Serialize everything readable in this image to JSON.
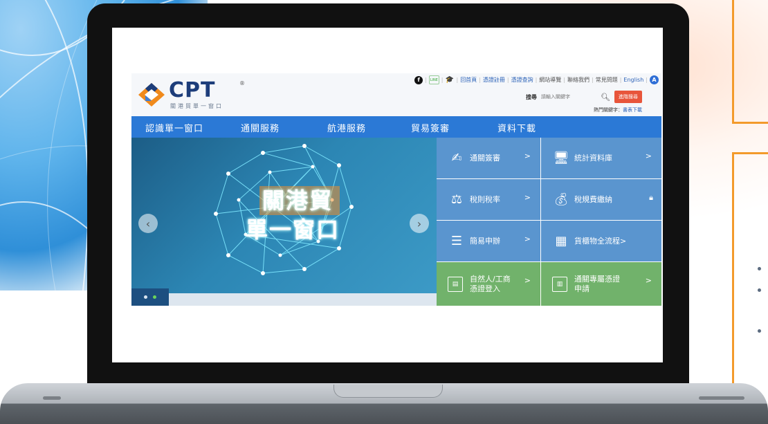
{
  "site": {
    "logo_text": "CPT",
    "logo_reg": "®",
    "logo_sub": "關港貿單一窗口",
    "toplinks": [
      "回首頁",
      "憑證註冊",
      "憑證查詢",
      "網站導覽",
      "聯絡我們",
      "常見問題",
      "English"
    ],
    "a11y_label": "A",
    "search_label": "搜尋",
    "search_placeholder": "請輸入關鍵字",
    "advanced_search": "進階搜尋",
    "hot_keywords_label": "熱門關鍵字：",
    "hot_keyword": "書表下載",
    "nav": [
      "認識單一窗口",
      "通關服務",
      "航港服務",
      "貿易簽審",
      "資料下載"
    ],
    "hero_caption_line1": "關港貿",
    "hero_caption_line2": "單一窗口",
    "tiles": [
      {
        "label": "通關簽審",
        "chevron": ">",
        "icon": "edit-icon",
        "color": "#5a95cf"
      },
      {
        "label": "統計資料庫",
        "chevron": ">",
        "icon": "monitor-icon",
        "color": "#5a95cf"
      },
      {
        "label": "稅則稅率",
        "chevron": ">",
        "icon": "scale-icon",
        "color": "#5a95cf"
      },
      {
        "label": "稅規費繳納",
        "chevron": "",
        "icon": "payment-icon",
        "color": "#5a95cf"
      },
      {
        "label": "簡易申辦",
        "chevron": ">",
        "icon": "list-icon",
        "color": "#5a95cf"
      },
      {
        "label": "貨櫃物全流程>",
        "chevron": "",
        "icon": "cargo-icon",
        "color": "#5a95cf"
      },
      {
        "label": "自然人/工商\n憑證登入",
        "chevron": ">",
        "icon": "id-card-icon",
        "color": "#71b26b"
      },
      {
        "label": "通關專屬憑證\n申請",
        "chevron": ">",
        "icon": "certificate-icon",
        "color": "#71b26b"
      }
    ],
    "carousel_active_index": 1,
    "colors": {
      "nav": "#2b79d6",
      "accent_orange": "#f39a2b",
      "search_btn": "#e8553b",
      "logo": "#1d3d7a"
    }
  }
}
